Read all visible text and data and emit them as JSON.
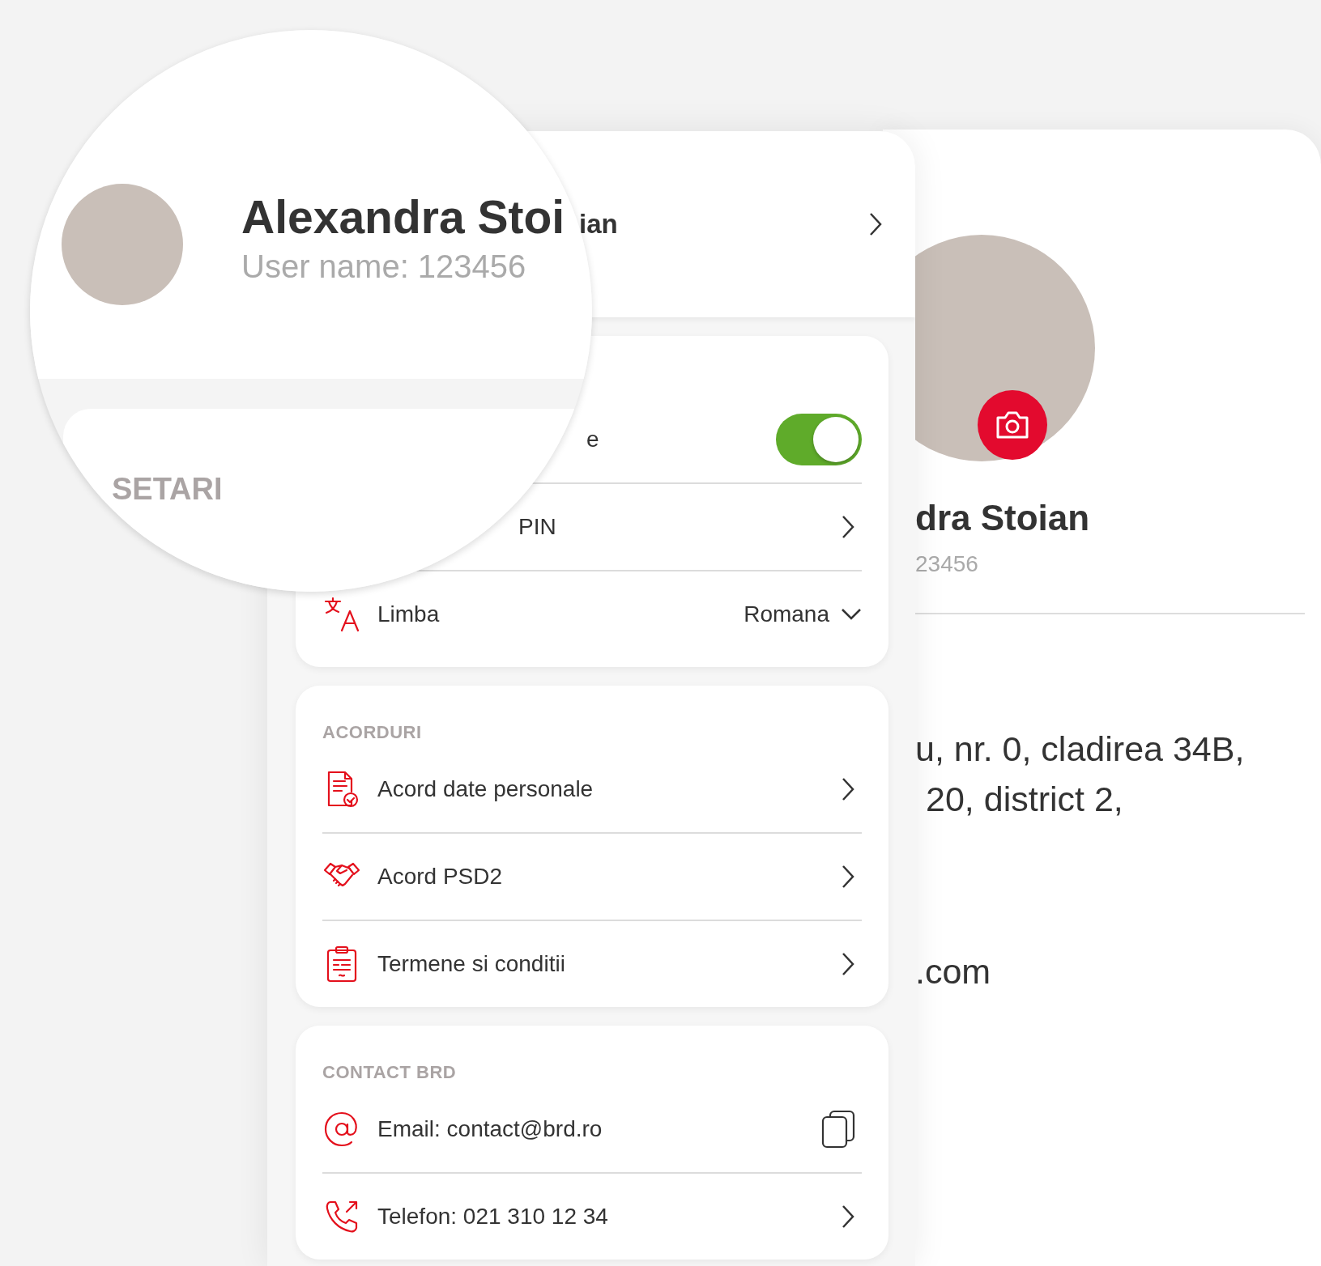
{
  "magnifier": {
    "name": "Alexandra Stoi",
    "username": "User name: 123456",
    "section_title": "SETARI"
  },
  "settings_screen": {
    "header_name": "ian",
    "cards": [
      {
        "rows": [
          {
            "kind": "toggle",
            "label": "e",
            "on": true
          },
          {
            "kind": "link",
            "label": "PIN"
          },
          {
            "kind": "select",
            "label": "Limba",
            "value": "Romana"
          }
        ]
      },
      {
        "title": "ACORDURI",
        "rows": [
          {
            "kind": "link",
            "label": "Acord date personale"
          },
          {
            "kind": "link",
            "label": "Acord PSD2"
          },
          {
            "kind": "link",
            "label": "Termene si conditii"
          }
        ]
      },
      {
        "title": "CONTACT BRD",
        "rows": [
          {
            "kind": "copy",
            "label": "Email: contact@brd.ro"
          },
          {
            "kind": "link",
            "label": "Telefon: 021 310 12 34"
          }
        ]
      }
    ]
  },
  "profile_screen": {
    "name": "dra Stoian",
    "username": "23456",
    "address_lines": [
      "u, nr. 0, cladirea 34B,",
      "20, district 2,"
    ],
    "email_fragment": ".com"
  }
}
